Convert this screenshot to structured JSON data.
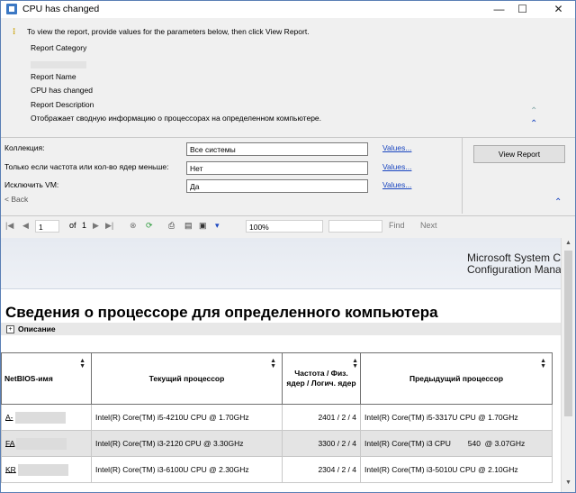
{
  "window": {
    "title": "CPU has changed",
    "minimize": "—",
    "maximize": "☐",
    "close": "✕"
  },
  "header": {
    "instruction": "To view the report, provide values for the parameters below, then click View Report.",
    "category_label": "Report Category",
    "name_label": "Report Name",
    "name_value": "CPU has changed",
    "description_label": "Report Description",
    "description_value": "Отображает сводную информацию о процессорах на определенном компьютере."
  },
  "params": [
    {
      "label": "Коллекция:",
      "value": "Все системы",
      "link": "Values..."
    },
    {
      "label": "Только если частота или кол-во ядер меньше:",
      "value": "Нет",
      "link": "Values..."
    },
    {
      "label": "Исключить VM:",
      "value": "Да",
      "link": "Values..."
    }
  ],
  "back_label": "< Back",
  "view_report_label": "View Report",
  "toolbar": {
    "page": "1",
    "of_label": "of",
    "total_pages": "1",
    "zoom": "100%",
    "find_label": "Find",
    "next_label": "Next"
  },
  "report": {
    "brand_line1": "Microsoft System C",
    "brand_line2": "Configuration Mana",
    "title": "Сведения о процессоре для определенного компьютера",
    "description_toggle": "Описание",
    "columns": [
      "NetBIOS-имя",
      "Текущий процессор",
      "Частота / Физ. ядер / Логич. ядер",
      "Предыдущий процессор"
    ],
    "rows": [
      {
        "name": "A-",
        "current": "Intel(R) Core(TM) i5-4210U CPU @ 1.70GHz",
        "freq": "2401 / 2 / 4",
        "previous": "Intel(R) Core(TM) i5-3317U CPU @ 1.70GHz"
      },
      {
        "name": "FA",
        "current": "Intel(R) Core(TM) i3-2120 CPU @ 3.30GHz",
        "freq": "3300 / 2 / 4",
        "previous": "Intel(R) Core(TM) i3 CPU        540  @ 3.07GHz"
      },
      {
        "name": "KR",
        "current": "Intel(R) Core(TM) i3-6100U CPU @ 2.30GHz",
        "freq": "2304 / 2 / 4",
        "previous": "Intel(R) Core(TM) i3-5010U CPU @ 2.10GHz"
      }
    ]
  }
}
